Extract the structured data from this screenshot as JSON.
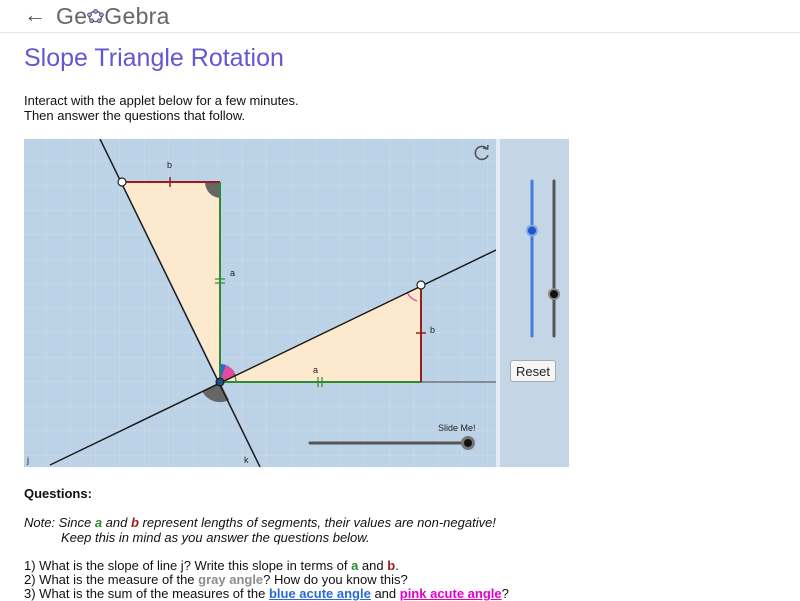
{
  "header": {
    "back_icon": "arrow-left-icon",
    "logo_text_left": "Ge",
    "logo_text_right": "Gebra"
  },
  "page": {
    "title": "Slope Triangle Rotation"
  },
  "intro": {
    "line1": "Interact with the applet below for a few minutes.",
    "line2": "Then answer the questions that follow."
  },
  "applet": {
    "labels": {
      "b_top": "b",
      "a_vertical": "a",
      "b_right": "b",
      "a_bottom": "a",
      "line_j": "j",
      "line_k": "k",
      "slide": "Slide Me!"
    },
    "reset_label": "Reset",
    "refresh_icon": "refresh-icon",
    "slider_left_value": 0.68,
    "slider_right_value": 0.27,
    "slide_me_value": 1.0,
    "colors": {
      "triangle_fill": "#fde9cd",
      "leg_b": "#9b1c1c",
      "leg_a": "#2e8a2e",
      "background": "#bcd3e7",
      "pink_angle": "#e24a9b",
      "blue_angle": "#2a6ad8",
      "gray_angle": "#666666"
    }
  },
  "questions": {
    "heading": "Questions:",
    "note": {
      "p1": "Note: Since ",
      "a": "a",
      "p2": " and ",
      "b": "b",
      "p3": " represent lengths of segments, their values are non-negative!",
      "line2": "Keep this in mind as you answer the questions below."
    },
    "q1": {
      "p1": "1) What is the slope of line j?  Write this slope in terms of ",
      "a": "a",
      "p2": " and ",
      "b": "b",
      "p3": "."
    },
    "q2": {
      "p1": "2) What is the measure of the ",
      "gray": "gray angle",
      "p2": "?  How do you know this?"
    },
    "q3": {
      "p1": "3) What is the sum of the measures of the ",
      "blue": "blue acute angle",
      "p2": " and ",
      "pink": "pink acute angle",
      "p3": "?"
    }
  }
}
